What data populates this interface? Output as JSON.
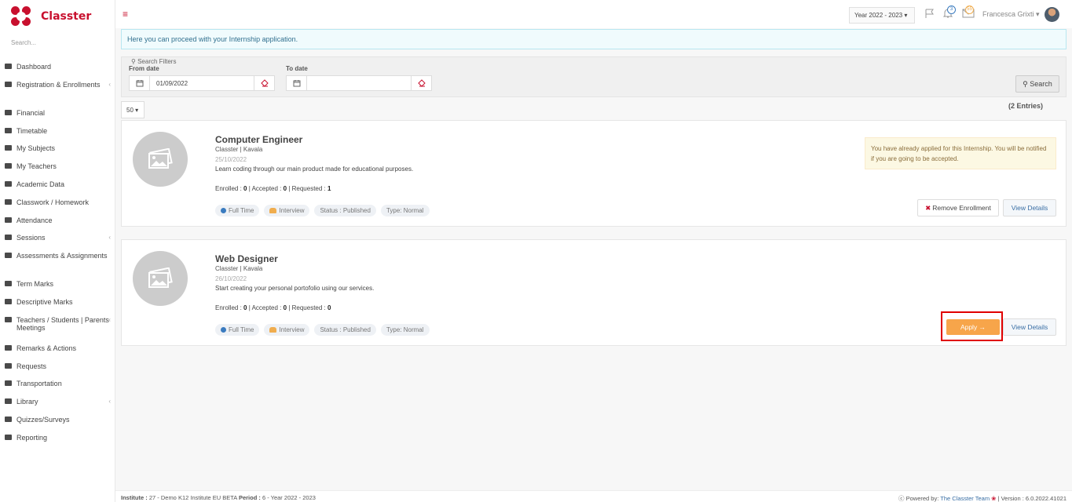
{
  "app": {
    "name": "Classter",
    "search_placeholder": "Search..."
  },
  "sidebar": {
    "items": [
      {
        "label": "Dashboard",
        "icon": "monitor-icon",
        "caret": false
      },
      {
        "label": "Registration & Enrollments",
        "icon": "bank-icon",
        "caret": true
      },
      {
        "label": "Financial",
        "icon": "coins-icon",
        "caret": false
      },
      {
        "label": "Timetable",
        "icon": "calendar-icon",
        "caret": false
      },
      {
        "label": "My Subjects",
        "icon": "books-icon",
        "caret": false
      },
      {
        "label": "My Teachers",
        "icon": "users-icon",
        "caret": false
      },
      {
        "label": "Academic Data",
        "icon": "id-card-icon",
        "caret": false
      },
      {
        "label": "Classwork / Homework",
        "icon": "list-icon",
        "caret": false
      },
      {
        "label": "Attendance",
        "icon": "user-x-icon",
        "caret": false
      },
      {
        "label": "Sessions",
        "icon": "sessions-icon",
        "caret": true
      },
      {
        "label": "Assessments & Assignments",
        "icon": "edit-icon",
        "caret": false
      },
      {
        "label": "Term Marks",
        "icon": "book-icon",
        "caret": false
      },
      {
        "label": "Descriptive Marks",
        "icon": "check-icon",
        "caret": false
      },
      {
        "label": "Teachers / Students | Parents Meetings",
        "icon": "meeting-icon",
        "caret": true
      },
      {
        "label": "Remarks & Actions",
        "icon": "shuffle-icon",
        "caret": false
      },
      {
        "label": "Requests",
        "icon": "document-icon",
        "caret": false
      },
      {
        "label": "Transportation",
        "icon": "bus-icon",
        "caret": false
      },
      {
        "label": "Library",
        "icon": "library-icon",
        "caret": true
      },
      {
        "label": "Quizzes/Surveys",
        "icon": "clipboard-icon",
        "caret": false
      },
      {
        "label": "Reporting",
        "icon": "printer-icon",
        "caret": false
      }
    ]
  },
  "topbar": {
    "year_label": "Year 2022 - 2023",
    "notifications_count": "3",
    "messages_count": "55",
    "user_name": "Francesca Grixti"
  },
  "info_message": "Here you can proceed with your Internship application.",
  "filters": {
    "legend": "Search Filters",
    "from_label": "From date",
    "from_value": "01/09/2022",
    "to_label": "To date",
    "to_value": "",
    "search_label": "Search"
  },
  "list": {
    "per_page": "50",
    "entries": "(2 Entries)"
  },
  "cards": [
    {
      "title": "Computer Engineer",
      "company": "Classter | Kavala",
      "date": "25/10/2022",
      "description": "Learn coding through our main product made for educational purposes.",
      "enrolled_label": "Enrolled :",
      "enrolled": "0",
      "accepted_label": "| Accepted :",
      "accepted": "0",
      "requested_label": "| Requested :",
      "requested": "1",
      "tags": [
        "Full Time",
        "Interview",
        "Status : Published",
        "Type: Normal"
      ],
      "notice": "You have already applied for this Internship. You will be notified if you are going to be accepted.",
      "remove_label": "Remove Enrollment",
      "details_label": "View Details"
    },
    {
      "title": "Web Designer",
      "company": "Classter | Kavala",
      "date": "26/10/2022",
      "description": "Start creating your personal portofolio using our services.",
      "enrolled_label": "Enrolled :",
      "enrolled": "0",
      "accepted_label": "| Accepted :",
      "accepted": "0",
      "requested_label": "| Requested :",
      "requested": "0",
      "tags": [
        "Full Time",
        "Interview",
        "Status : Published",
        "Type: Normal"
      ],
      "apply_label": "Apply →",
      "details_label": "View Details"
    }
  ],
  "footer": {
    "institute_label": "Institute :",
    "institute_value": "27 - Demo K12 Institute EU BETA",
    "period_label": "Period :",
    "period_value": "6 - Year 2022 - 2023",
    "powered_label": "Powered by:",
    "powered_link": "The Classter Team",
    "version": "| Version : 6.0.2022.41021"
  },
  "colors": {
    "brand": "#c8102e",
    "apply": "#f7a54a",
    "link": "#3a6fa5",
    "highlight": "#e00000"
  }
}
